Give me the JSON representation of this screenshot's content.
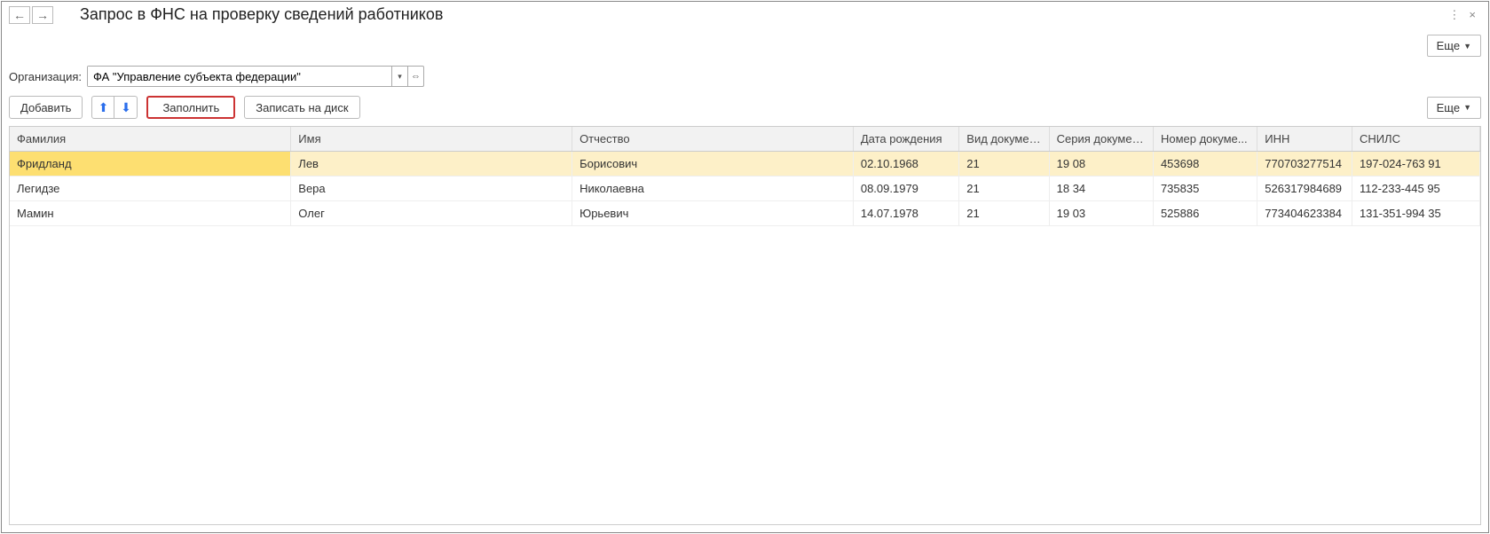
{
  "header": {
    "title": "Запрос в ФНС на проверку сведений работников",
    "nav_back_icon": "←",
    "nav_forward_icon": "→",
    "more_icon": "⋮",
    "close_icon": "×"
  },
  "more_button": "Еще",
  "organization": {
    "label": "Организация:",
    "value": "ФА \"Управление субъекта федерации\"",
    "dropdown_icon": "▾",
    "popup_icon": "⇔"
  },
  "toolbar": {
    "add": "Добавить",
    "up_icon": "⬆",
    "down_icon": "⬇",
    "fill": "Заполнить",
    "save_to_disk": "Записать на диск"
  },
  "table": {
    "headers": {
      "lastname": "Фамилия",
      "firstname": "Имя",
      "patronymic": "Отчество",
      "dob": "Дата рождения",
      "doctype": "Вид документа",
      "docseries": "Серия документа",
      "docnum": "Номер докуме...",
      "inn": "ИНН",
      "snils": "СНИЛС"
    },
    "rows": [
      {
        "lastname": "Фридланд",
        "firstname": "Лев",
        "patronymic": "Борисович",
        "dob": "02.10.1968",
        "doctype": "21",
        "docseries": "19 08",
        "docnum": "453698",
        "inn": "770703277514",
        "snils": "197-024-763 91",
        "selected": true
      },
      {
        "lastname": "Легидзе",
        "firstname": "Вера",
        "patronymic": "Николаевна",
        "dob": "08.09.1979",
        "doctype": "21",
        "docseries": "18 34",
        "docnum": "735835",
        "inn": "526317984689",
        "snils": "112-233-445 95",
        "selected": false
      },
      {
        "lastname": "Мамин",
        "firstname": "Олег",
        "patronymic": "Юрьевич",
        "dob": "14.07.1978",
        "doctype": "21",
        "docseries": "19 03",
        "docnum": "525886",
        "inn": "773404623384",
        "snils": "131-351-994 35",
        "selected": false
      }
    ]
  }
}
